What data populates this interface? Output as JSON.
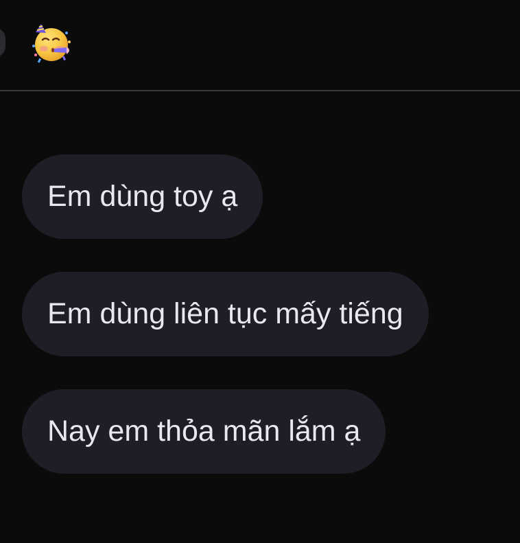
{
  "header": {
    "emoji_name": "partying-face-emoji"
  },
  "messages": [
    {
      "text": "Em dùng toy ạ"
    },
    {
      "text": "Em dùng liên tục mấy tiếng"
    },
    {
      "text": "Nay em thỏa mãn lắm ạ"
    }
  ],
  "colors": {
    "background": "#0b0b0c",
    "bubble": "#1f1e27",
    "bubble_text": "#e8e8ef",
    "divider": "#3a3a3f"
  }
}
